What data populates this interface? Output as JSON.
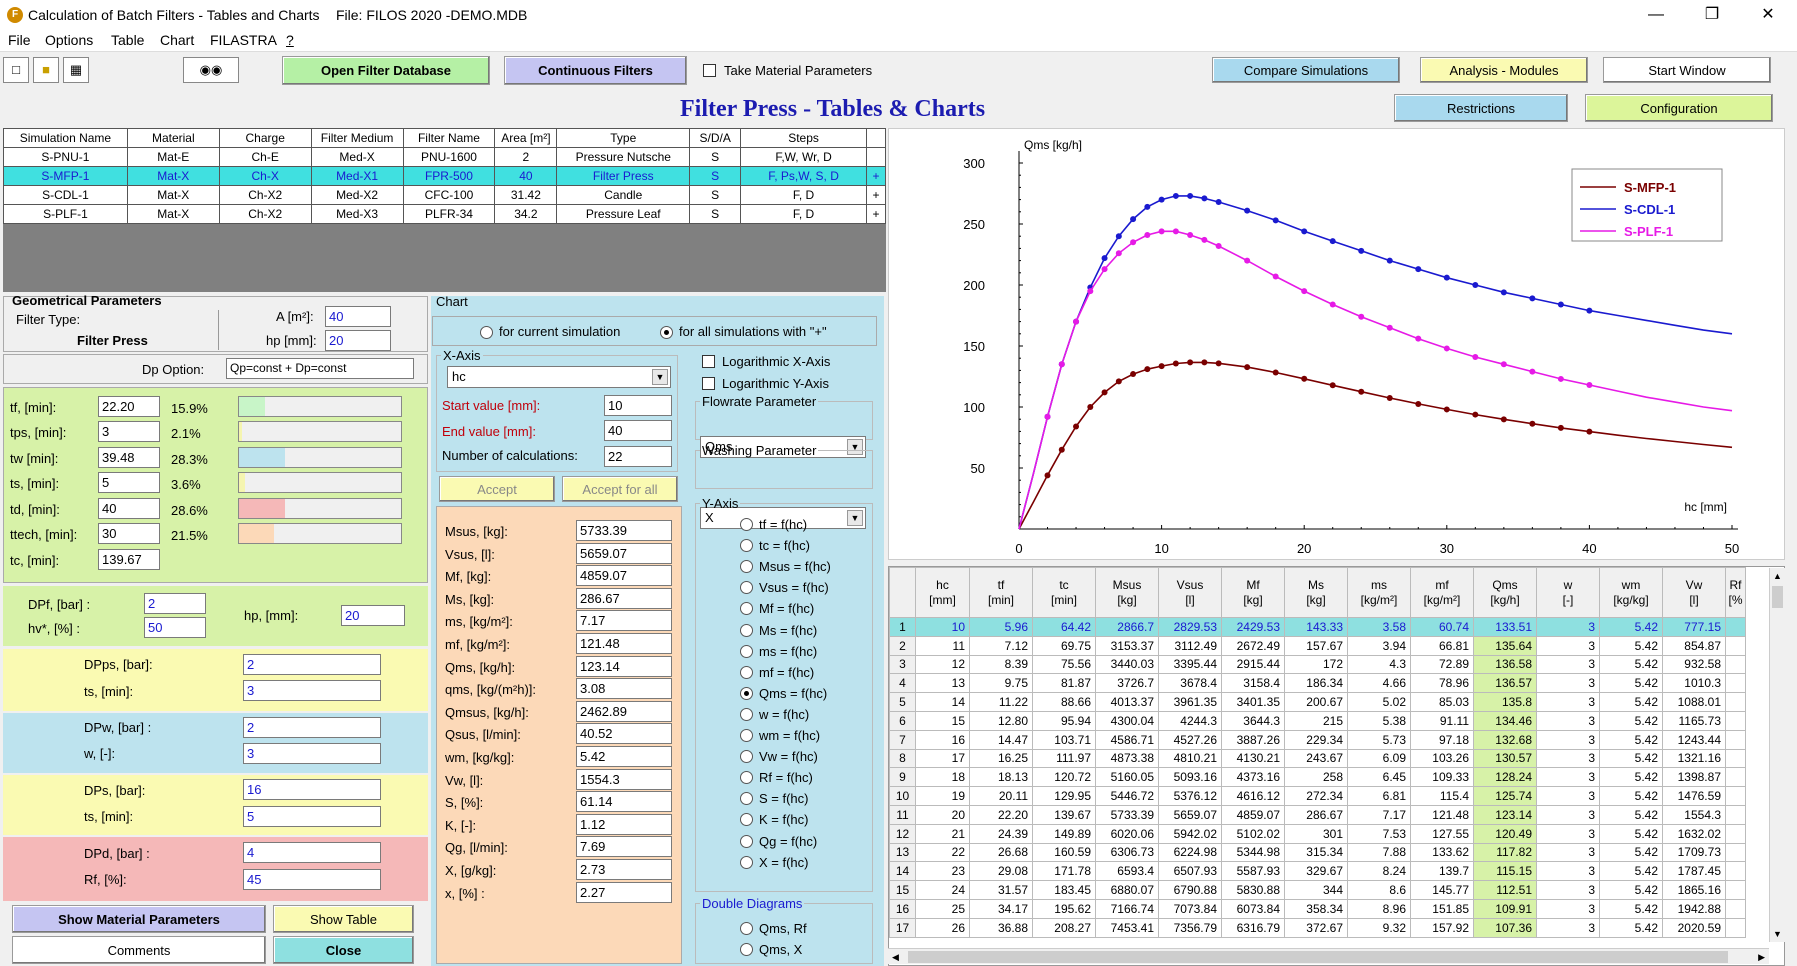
{
  "window": {
    "title": "Calculation of Batch Filters - Tables and Charts",
    "file": "File: FILOS 2020 -DEMO.MDB"
  },
  "menu": [
    "File",
    "Options",
    "Table",
    "Chart",
    "FILASTRA",
    "?"
  ],
  "toolbar": {
    "open_db": "Open Filter Database",
    "continuous": "Continuous Filters",
    "take_material": "Take Material Parameters",
    "compare": "Compare Simulations",
    "analysis": "Analysis - Modules",
    "start_window": "Start Window",
    "restrictions": "Restrictions",
    "configuration": "Configuration"
  },
  "heading": "Filter Press - Tables & Charts",
  "sim_table": {
    "headers": [
      "Simulation Name",
      "Material",
      "Charge",
      "Filter Medium",
      "Filter Name",
      "Area [m²]",
      "Type",
      "S/D/A",
      "Steps",
      ""
    ],
    "rows": [
      [
        "S-PNU-1",
        "Mat-E",
        "Ch-E",
        "Med-X",
        "PNU-1600",
        "2",
        "Pressure Nutsche",
        "S",
        "F,W, Wr, D",
        ""
      ],
      [
        "S-MFP-1",
        "Mat-X",
        "Ch-X",
        "Med-X1",
        "FPR-500",
        "40",
        "Filter Press",
        "S",
        "F, Ps,W, S, D",
        "+"
      ],
      [
        "S-CDL-1",
        "Mat-X",
        "Ch-X2",
        "Med-X2",
        "CFC-100",
        "31.42",
        "Candle",
        "S",
        "F, D",
        "+"
      ],
      [
        "S-PLF-1",
        "Mat-X",
        "Ch-X2",
        "Med-X3",
        "PLFR-34",
        "34.2",
        "Pressure Leaf",
        "S",
        "F, D",
        "+"
      ]
    ]
  },
  "geom": {
    "title": "Geometrical Parameters",
    "filter_type_label": "Filter Type:",
    "filter_type": "Filter Press",
    "a_label": "A [m²]:",
    "a_value": "40",
    "hp_label": "hp [mm]:",
    "hp_value": "20",
    "dp_option_label": "Dp Option:",
    "dp_option_value": "Qp=const + Dp=const"
  },
  "times": [
    {
      "label": "tf, [min]:",
      "value": "22.20",
      "pct": "15.9%",
      "frac": 0.159,
      "color": "#c8f5c8"
    },
    {
      "label": "tps, [min]:",
      "value": "3",
      "pct": "2.1%",
      "frac": 0.021,
      "color": "#f5f5b0"
    },
    {
      "label": "tw [min]:",
      "value": "39.48",
      "pct": "28.3%",
      "frac": 0.283,
      "color": "#bde3ee"
    },
    {
      "label": "ts, [min]:",
      "value": "5",
      "pct": "3.6%",
      "frac": 0.036,
      "color": "#f5f5b0"
    },
    {
      "label": "td, [min]:",
      "value": "40",
      "pct": "28.6%",
      "frac": 0.286,
      "color": "#f5b8b8"
    },
    {
      "label": "ttech, [min]:",
      "value": "30",
      "pct": "21.5%",
      "frac": 0.215,
      "color": "#fcd9b8"
    },
    {
      "label": "tc, [min]:",
      "value": "139.67",
      "pct": "",
      "frac": 0,
      "color": ""
    }
  ],
  "dpf": {
    "label": "DPf, [bar] :",
    "value": "2",
    "hv_label": "hv*, [%] :",
    "hv_value": "50",
    "hp_label": "hp, [mm]:",
    "hp_value": "20"
  },
  "dpps": {
    "label": "DPps, [bar]:",
    "value": "2",
    "ts_label": "ts, [min]:",
    "ts_value": "3"
  },
  "dpw": {
    "label": "DPw, [bar] :",
    "value": "2",
    "w_label": "w, [-]:",
    "w_value": "3"
  },
  "dps": {
    "label": "DPs, [bar]:",
    "value": "16",
    "ts_label": "ts, [min]:",
    "ts_value": "5"
  },
  "dpd": {
    "label": "DPd, [bar] :",
    "value": "4",
    "rf_label": "Rf, [%]:",
    "rf_value": "45"
  },
  "bottom_buttons": {
    "show_material": "Show Material Parameters",
    "show_table": "Show Table",
    "comments": "Comments",
    "close": "Close"
  },
  "chart_panel": {
    "title": "Chart",
    "radio_current": "for current simulation",
    "radio_all": "for all simulations with  \"+\"",
    "xaxis_legend": "X-Axis",
    "xaxis_value": "hc",
    "start_label": "Start value [mm]:",
    "start_value": "10",
    "end_label": "End value [mm]:",
    "end_value": "40",
    "ncalc_label": "Number of calculations:",
    "ncalc_value": "22",
    "accept": "Accept",
    "accept_all": "Accept for all",
    "log_x": "Logarithmic X-Axis",
    "log_y": "Logarithmic Y-Axis",
    "flowrate_legend": "Flowrate Parameter",
    "flowrate_value": "Qms",
    "washing_legend": "Washing Parameter",
    "washing_value": "X",
    "yaxis_legend": "Y-Axis",
    "yaxis_options": [
      "tf = f(hc)",
      "tc = f(hc)",
      "Msus = f(hc)",
      "Vsus = f(hc)",
      "Mf = f(hc)",
      "Ms = f(hc)",
      "ms = f(hc)",
      "mf = f(hc)",
      "Qms = f(hc)",
      "w = f(hc)",
      "wm = f(hc)",
      "Vw = f(hc)",
      "Rf = f(hc)",
      "S = f(hc)",
      "K = f(hc)",
      "Qg = f(hc)",
      "X = f(hc)"
    ],
    "yaxis_selected": 8,
    "double_legend": "Double Diagrams",
    "double_options": [
      "Qms, Rf",
      "Qms, X"
    ]
  },
  "results": [
    {
      "label": "Msus, [kg]:",
      "value": "5733.39"
    },
    {
      "label": "Vsus, [l]:",
      "value": "5659.07"
    },
    {
      "label": "Mf, [kg]:",
      "value": "4859.07"
    },
    {
      "label": "Ms, [kg]:",
      "value": "286.67"
    },
    {
      "label": "ms, [kg/m²]:",
      "value": "7.17"
    },
    {
      "label": "mf, [kg/m²]:",
      "value": "121.48"
    },
    {
      "label": "Qms, [kg/h]:",
      "value": "123.14"
    },
    {
      "label": "qms, [kg/(m²h)]:",
      "value": "3.08"
    },
    {
      "label": "Qmsus, [kg/h]:",
      "value": "2462.89"
    },
    {
      "label": "Qsus, [l/min]:",
      "value": "40.52"
    },
    {
      "label": "wm, [kg/kg]:",
      "value": "5.42"
    },
    {
      "label": "Vw, [l]:",
      "value": "1554.3"
    },
    {
      "label": "S, [%]:",
      "value": "61.14"
    },
    {
      "label": "K, [-]:",
      "value": "1.12"
    },
    {
      "label": "Qg, [l/min]:",
      "value": "7.69"
    },
    {
      "label": "X, [g/kg]:",
      "value": "2.73"
    },
    {
      "label": "x, [%] :",
      "value": "2.27"
    }
  ],
  "chart_data": {
    "type": "line",
    "xlabel": "hc [mm]",
    "ylabel": "Qms [kg/h]",
    "xlim": [
      0,
      50
    ],
    "ylim": [
      0,
      300
    ],
    "xticks": [
      0,
      10,
      20,
      30,
      40,
      50
    ],
    "yticks": [
      50,
      100,
      150,
      200,
      250,
      300
    ],
    "legend_position": "top-right",
    "series": [
      {
        "name": "S-MFP-1",
        "color": "#7a0000",
        "x": [
          0,
          1,
          2,
          3,
          4,
          5,
          6,
          7,
          8,
          9,
          10,
          11,
          12,
          13,
          14,
          16,
          18,
          20,
          22,
          24,
          26,
          28,
          30,
          32,
          34,
          36,
          38,
          40,
          42,
          44,
          46,
          48,
          50
        ],
        "y": [
          0,
          22,
          44,
          65,
          84,
          100,
          112,
          121,
          127,
          131,
          133.51,
          135.64,
          136.58,
          136.57,
          135.8,
          132.68,
          128.24,
          123.14,
          117.82,
          112.51,
          107.36,
          102.5,
          98,
          93.8,
          89.9,
          86.3,
          82.9,
          79.8,
          76.9,
          74.2,
          71.7,
          69.3,
          67
        ]
      },
      {
        "name": "S-CDL-1",
        "color": "#1a1acf",
        "x": [
          0,
          1,
          2,
          3,
          4,
          5,
          6,
          7,
          8,
          9,
          10,
          11,
          12,
          13,
          14,
          16,
          18,
          20,
          22,
          24,
          26,
          28,
          30,
          32,
          34,
          36,
          38,
          40,
          42,
          44,
          46,
          48,
          50
        ],
        "y": [
          0,
          45,
          92,
          135,
          170,
          198,
          222,
          240,
          254,
          264,
          270,
          273,
          273,
          271,
          268,
          261,
          253,
          244,
          236,
          228,
          220,
          213,
          206,
          200,
          194,
          189,
          184,
          179,
          175,
          171,
          167,
          163,
          160
        ]
      },
      {
        "name": "S-PLF-1",
        "color": "#e61ae6",
        "x": [
          0,
          1,
          2,
          3,
          4,
          5,
          6,
          7,
          8,
          9,
          10,
          11,
          12,
          13,
          14,
          16,
          18,
          20,
          22,
          24,
          26,
          28,
          30,
          32,
          34,
          36,
          38,
          40,
          42,
          44,
          46,
          48,
          50
        ],
        "y": [
          0,
          45,
          92,
          135,
          170,
          195,
          213,
          226,
          235,
          241,
          244,
          244,
          241,
          237,
          232,
          220,
          207,
          195,
          184,
          174,
          165,
          156,
          148,
          141,
          135,
          129,
          123,
          118,
          113,
          108,
          104,
          100,
          97
        ]
      }
    ]
  },
  "data_table": {
    "headers": [
      [
        "",
        ""
      ],
      [
        "hc",
        "[mm]"
      ],
      [
        "tf",
        "[min]"
      ],
      [
        "tc",
        "[min]"
      ],
      [
        "Msus",
        "[kg]"
      ],
      [
        "Vsus",
        "[l]"
      ],
      [
        "Mf",
        "[kg]"
      ],
      [
        "Ms",
        "[kg]"
      ],
      [
        "ms",
        "[kg/m²]"
      ],
      [
        "mf",
        "[kg/m²]"
      ],
      [
        "Qms",
        "[kg/h]"
      ],
      [
        "w",
        "[-]"
      ],
      [
        "wm",
        "[kg/kg]"
      ],
      [
        "Vw",
        "[l]"
      ],
      [
        "Rf",
        "[%"
      ]
    ],
    "rows": [
      [
        "1",
        "10",
        "5.96",
        "64.42",
        "2866.7",
        "2829.53",
        "2429.53",
        "143.33",
        "3.58",
        "60.74",
        "133.51",
        "3",
        "5.42",
        "777.15",
        ""
      ],
      [
        "2",
        "11",
        "7.12",
        "69.75",
        "3153.37",
        "3112.49",
        "2672.49",
        "157.67",
        "3.94",
        "66.81",
        "135.64",
        "3",
        "5.42",
        "854.87",
        ""
      ],
      [
        "3",
        "12",
        "8.39",
        "75.56",
        "3440.03",
        "3395.44",
        "2915.44",
        "172",
        "4.3",
        "72.89",
        "136.58",
        "3",
        "5.42",
        "932.58",
        ""
      ],
      [
        "4",
        "13",
        "9.75",
        "81.87",
        "3726.7",
        "3678.4",
        "3158.4",
        "186.34",
        "4.66",
        "78.96",
        "136.57",
        "3",
        "5.42",
        "1010.3",
        ""
      ],
      [
        "5",
        "14",
        "11.22",
        "88.66",
        "4013.37",
        "3961.35",
        "3401.35",
        "200.67",
        "5.02",
        "85.03",
        "135.8",
        "3",
        "5.42",
        "1088.01",
        ""
      ],
      [
        "6",
        "15",
        "12.80",
        "95.94",
        "4300.04",
        "4244.3",
        "3644.3",
        "215",
        "5.38",
        "91.11",
        "134.46",
        "3",
        "5.42",
        "1165.73",
        ""
      ],
      [
        "7",
        "16",
        "14.47",
        "103.71",
        "4586.71",
        "4527.26",
        "3887.26",
        "229.34",
        "5.73",
        "97.18",
        "132.68",
        "3",
        "5.42",
        "1243.44",
        ""
      ],
      [
        "8",
        "17",
        "16.25",
        "111.97",
        "4873.38",
        "4810.21",
        "4130.21",
        "243.67",
        "6.09",
        "103.26",
        "130.57",
        "3",
        "5.42",
        "1321.16",
        ""
      ],
      [
        "9",
        "18",
        "18.13",
        "120.72",
        "5160.05",
        "5093.16",
        "4373.16",
        "258",
        "6.45",
        "109.33",
        "128.24",
        "3",
        "5.42",
        "1398.87",
        ""
      ],
      [
        "10",
        "19",
        "20.11",
        "129.95",
        "5446.72",
        "5376.12",
        "4616.12",
        "272.34",
        "6.81",
        "115.4",
        "125.74",
        "3",
        "5.42",
        "1476.59",
        ""
      ],
      [
        "11",
        "20",
        "22.20",
        "139.67",
        "5733.39",
        "5659.07",
        "4859.07",
        "286.67",
        "7.17",
        "121.48",
        "123.14",
        "3",
        "5.42",
        "1554.3",
        ""
      ],
      [
        "12",
        "21",
        "24.39",
        "149.89",
        "6020.06",
        "5942.02",
        "5102.02",
        "301",
        "7.53",
        "127.55",
        "120.49",
        "3",
        "5.42",
        "1632.02",
        ""
      ],
      [
        "13",
        "22",
        "26.68",
        "160.59",
        "6306.73",
        "6224.98",
        "5344.98",
        "315.34",
        "7.88",
        "133.62",
        "117.82",
        "3",
        "5.42",
        "1709.73",
        ""
      ],
      [
        "14",
        "23",
        "29.08",
        "171.78",
        "6593.4",
        "6507.93",
        "5587.93",
        "329.67",
        "8.24",
        "139.7",
        "115.15",
        "3",
        "5.42",
        "1787.45",
        ""
      ],
      [
        "15",
        "24",
        "31.57",
        "183.45",
        "6880.07",
        "6790.88",
        "5830.88",
        "344",
        "8.6",
        "145.77",
        "112.51",
        "3",
        "5.42",
        "1865.16",
        ""
      ],
      [
        "16",
        "25",
        "34.17",
        "195.62",
        "7166.74",
        "7073.84",
        "6073.84",
        "358.34",
        "8.96",
        "151.85",
        "109.91",
        "3",
        "5.42",
        "1942.88",
        ""
      ],
      [
        "17",
        "26",
        "36.88",
        "208.27",
        "7453.41",
        "7356.79",
        "6316.79",
        "372.67",
        "9.32",
        "157.92",
        "107.36",
        "3",
        "5.42",
        "2020.59",
        ""
      ]
    ]
  }
}
